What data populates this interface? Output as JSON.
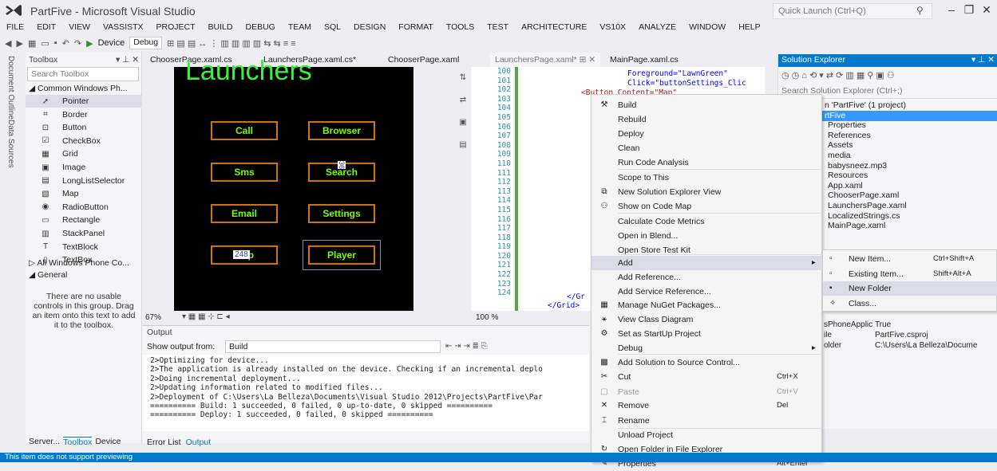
{
  "window": {
    "title": "PartFive - Microsoft Visual Studio",
    "quick_launch_placeholder": "Quick Launch (Ctrl+Q)"
  },
  "menubar": [
    "FILE",
    "EDIT",
    "VIEW",
    "VASSISTX",
    "PROJECT",
    "BUILD",
    "DEBUG",
    "TEAM",
    "SQL",
    "DESIGN",
    "FORMAT",
    "TOOLS",
    "TEST",
    "ARCHITECTURE",
    "VS10X",
    "ANALYZE",
    "WINDOW",
    "HELP"
  ],
  "toolbar": {
    "device": "Device",
    "config": "Debug"
  },
  "vtabs": [
    "Document Outline",
    "Data Sources"
  ],
  "toolbox": {
    "title": "Toolbox",
    "search_placeholder": "Search Toolbox",
    "group_common": "Common Windows Ph...",
    "items": [
      {
        "label": "Pointer",
        "icon": "pointer-icon"
      },
      {
        "label": "Border",
        "icon": "border-icon"
      },
      {
        "label": "Button",
        "icon": "button-icon"
      },
      {
        "label": "CheckBox",
        "icon": "checkbox-icon"
      },
      {
        "label": "Grid",
        "icon": "grid-icon"
      },
      {
        "label": "Image",
        "icon": "image-icon"
      },
      {
        "label": "LongListSelector",
        "icon": "list-icon"
      },
      {
        "label": "Map",
        "icon": "map-icon"
      },
      {
        "label": "RadioButton",
        "icon": "radio-icon"
      },
      {
        "label": "Rectangle",
        "icon": "rectangle-icon"
      },
      {
        "label": "StackPanel",
        "icon": "stackpanel-icon"
      },
      {
        "label": "TextBlock",
        "icon": "textblock-icon"
      },
      {
        "label": "TextBox",
        "icon": "textbox-icon"
      }
    ],
    "group_all": "All Windows Phone Co...",
    "group_general": "General",
    "empty_text": "There are no usable controls in this group. Drag an item onto this text to add it to the toolbox.",
    "bottom_tabs": [
      "Server...",
      "Toolbox",
      "Device"
    ]
  },
  "doctabs": [
    "ChooserPage.xaml.cs",
    "LaunchersPage.xaml.cs*",
    "ChooserPage.xaml",
    "LaunchersPage.xaml*",
    "MainPage.xaml.cs"
  ],
  "designer": {
    "page_title": "Launchers",
    "buttons": [
      "Call",
      "Browser",
      "Sms",
      "Search",
      "Email",
      "Settings",
      "Map",
      "Player"
    ],
    "zoom": "67%",
    "width_label": "248",
    "height_label": "36"
  },
  "editor": {
    "line_numbers": [
      "100",
      "101",
      "102",
      "103",
      "104",
      "105",
      "106",
      "107",
      "108",
      "109",
      "110",
      "111",
      "112",
      "113",
      "114",
      "115",
      "116",
      "117",
      "118",
      "119",
      "120",
      "121",
      "122",
      "123",
      "124"
    ],
    "code_lines": [
      "Foreground=\"LawnGreen\"",
      "Click=\"buttonSettings_Clic",
      "<Button Content=\"Map\""
    ],
    "end_lines": [
      "</Gr",
      "</Grid>"
    ],
    "zoom": "100 %"
  },
  "output": {
    "title": "Output",
    "show_from_label": "Show output from:",
    "source": "Build",
    "lines": [
      "2>Optimizing for device...",
      "2>The application is already installed on the device. Checking if an incremental deplo",
      "2>Doing incremental deployment...",
      "2>Updating information related to modified files...",
      "2>Deployment of C:\\Users\\La Belleza\\Documents\\Visual Studio 2012\\Projects\\PartFive\\Par",
      "========== Build: 1 succeeded, 0 failed, 0 up-to-date, 0 skipped ==========",
      "========== Deploy: 1 succeeded, 0 failed, 0 skipped =========="
    ],
    "bottom_tabs": [
      "Error List",
      "Output"
    ]
  },
  "solution_explorer": {
    "title": "Solution Explorer",
    "search_placeholder": "Search Solution Explorer (Ctrl+;)",
    "items": [
      "n 'PartFive' (1 project)",
      "rtFive",
      "Properties",
      "References",
      "Assets",
      "media",
      "babysneez.mp3",
      "Resources",
      "App.xaml",
      "ChooserPage.xaml",
      "LaunchersPage.xaml",
      "LocalizedStrings.cs",
      "MainPage.xaml"
    ]
  },
  "context_menu": [
    {
      "label": "Build",
      "icon": "build-icon",
      "shortcut": ""
    },
    {
      "label": "Rebuild",
      "icon": "",
      "shortcut": ""
    },
    {
      "label": "Deploy",
      "icon": "",
      "shortcut": ""
    },
    {
      "label": "Clean",
      "icon": "",
      "shortcut": ""
    },
    {
      "label": "Run Code Analysis",
      "icon": "",
      "shortcut": ""
    },
    {
      "label": "Scope to This",
      "icon": "",
      "shortcut": ""
    },
    {
      "label": "New Solution Explorer View",
      "icon": "new-view-icon",
      "shortcut": ""
    },
    {
      "label": "Show on Code Map",
      "icon": "codemap-icon",
      "shortcut": ""
    },
    {
      "label": "Calculate Code Metrics",
      "icon": "",
      "shortcut": ""
    },
    {
      "label": "Open in Blend...",
      "icon": "",
      "shortcut": ""
    },
    {
      "label": "Open Store Test Kit",
      "icon": "",
      "shortcut": ""
    },
    {
      "label": "Add",
      "icon": "",
      "shortcut": ""
    },
    {
      "label": "Add Reference...",
      "icon": "",
      "shortcut": ""
    },
    {
      "label": "Add Service Reference...",
      "icon": "",
      "shortcut": ""
    },
    {
      "label": "Manage NuGet Packages...",
      "icon": "nuget-icon",
      "shortcut": ""
    },
    {
      "label": "View Class Diagram",
      "icon": "class-diagram-icon",
      "shortcut": ""
    },
    {
      "label": "Set as StartUp Project",
      "icon": "gear-icon",
      "shortcut": ""
    },
    {
      "label": "Debug",
      "icon": "",
      "shortcut": ""
    },
    {
      "label": "Add Solution to Source Control...",
      "icon": "source-control-icon",
      "shortcut": ""
    },
    {
      "label": "Cut",
      "icon": "cut-icon",
      "shortcut": "Ctrl+X"
    },
    {
      "label": "Paste",
      "icon": "paste-icon",
      "shortcut": "Ctrl+V"
    },
    {
      "label": "Remove",
      "icon": "remove-icon",
      "shortcut": "Del"
    },
    {
      "label": "Rename",
      "icon": "rename-icon",
      "shortcut": ""
    },
    {
      "label": "Unload Project",
      "icon": "",
      "shortcut": ""
    },
    {
      "label": "Open Folder in File Explorer",
      "icon": "open-folder-icon",
      "shortcut": ""
    },
    {
      "label": "Properties",
      "icon": "wrench-icon",
      "shortcut": "Alt+Enter"
    }
  ],
  "add_submenu": [
    {
      "label": "New Item...",
      "shortcut": "Ctrl+Shift+A"
    },
    {
      "label": "Existing Item...",
      "shortcut": "Shift+Alt+A"
    },
    {
      "label": "New Folder",
      "shortcut": ""
    },
    {
      "label": "Class...",
      "shortcut": ""
    }
  ],
  "properties": {
    "rows": [
      {
        "name": "sPhoneApplic",
        "value": "True"
      },
      {
        "name": "ile",
        "value": "PartFive.csproj"
      },
      {
        "name": "older",
        "value": "C:\\Users\\La Belleza\\Docume"
      }
    ]
  },
  "status": {
    "text": "This item does not support previewing"
  },
  "colors": {
    "accent": "#007acc",
    "phone_text": "#3ef03e",
    "button_border": "#c8741a"
  }
}
